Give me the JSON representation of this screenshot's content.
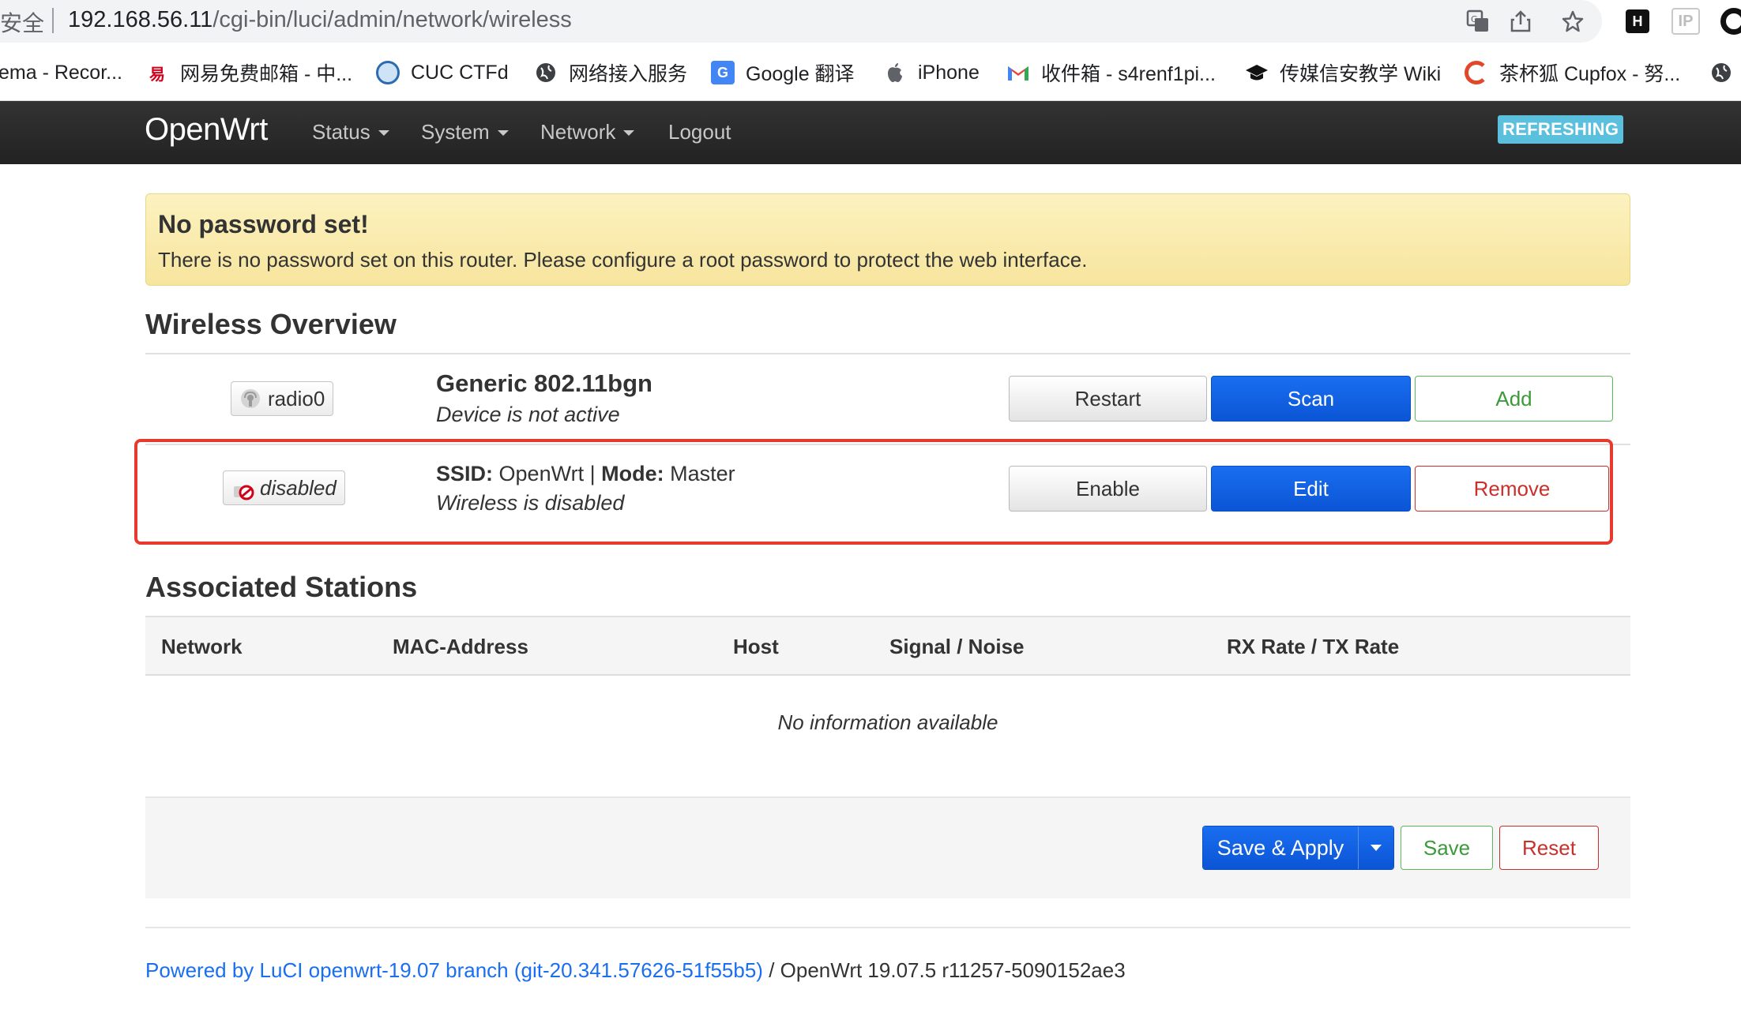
{
  "browser": {
    "security_label": "安全",
    "url_host": "192.168.56.11",
    "url_path": "/cgi-bin/luci/admin/network/wireless",
    "ext_h": "H",
    "ext_ip": "IP"
  },
  "bookmarks": [
    {
      "label": "ema - Recor...",
      "icon": "document-icon"
    },
    {
      "label": "网易免费邮箱 - 中...",
      "icon": "netease-icon"
    },
    {
      "label": "CUC CTFd",
      "icon": "ctfd-icon"
    },
    {
      "label": "网络接入服务",
      "icon": "globe-icon"
    },
    {
      "label": "Google 翻译",
      "icon": "google-translate-icon"
    },
    {
      "label": "iPhone",
      "icon": "apple-icon"
    },
    {
      "label": "收件箱 - s4renf1pi...",
      "icon": "gmail-icon"
    },
    {
      "label": "传媒信安教学 Wiki",
      "icon": "graduation-cap-icon"
    },
    {
      "label": "茶杯狐 Cupfox - 努...",
      "icon": "cupfox-icon"
    }
  ],
  "header": {
    "brand": "OpenWrt",
    "nav": [
      "Status",
      "System",
      "Network",
      "Logout"
    ],
    "status_badge": "REFRESHING"
  },
  "alert": {
    "title": "No password set!",
    "message": "There is no password set on this router. Please configure a root password to protect the web interface."
  },
  "wireless": {
    "heading": "Wireless Overview",
    "device": {
      "badge": "radio0",
      "title": "Generic 802.11bgn",
      "status": "Device is not active",
      "buttons": {
        "restart": "Restart",
        "scan": "Scan",
        "add": "Add"
      }
    },
    "network": {
      "badge": "disabled",
      "ssid_label": "SSID:",
      "ssid_value": "OpenWrt",
      "separator": "|",
      "mode_label": "Mode:",
      "mode_value": "Master",
      "status": "Wireless is disabled",
      "buttons": {
        "enable": "Enable",
        "edit": "Edit",
        "remove": "Remove"
      }
    }
  },
  "stations": {
    "heading": "Associated Stations",
    "columns": [
      "Network",
      "MAC-Address",
      "Host",
      "Signal / Noise",
      "RX Rate / TX Rate"
    ],
    "empty": "No information available"
  },
  "actions": {
    "save_apply": "Save & Apply",
    "save": "Save",
    "reset": "Reset"
  },
  "footer": {
    "link_text": "Powered by LuCI openwrt-19.07 branch (git-20.341.57626-51f55b5)",
    "suffix": " / OpenWrt 19.07.5 r11257-5090152ae3"
  },
  "colors": {
    "primary": "#0b55d6",
    "success": "#3c9a3c",
    "danger": "#c9302c",
    "info": "#5bc0de",
    "warning_bg": "#fbeea9",
    "highlight": "#e8392f"
  }
}
